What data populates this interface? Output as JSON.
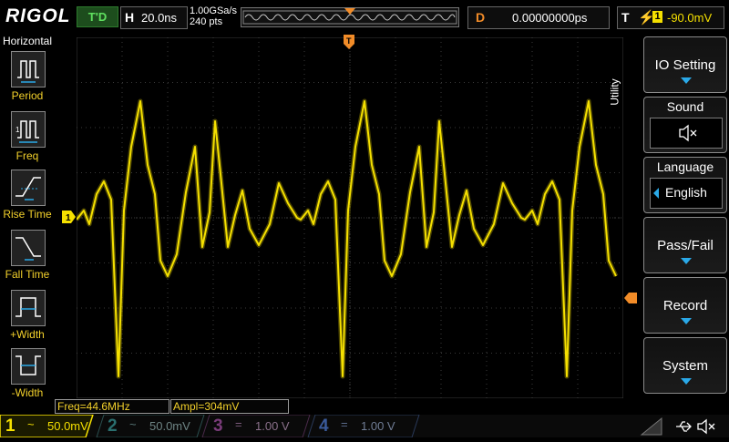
{
  "top": {
    "logo": "RIGOL",
    "trigger_status": "T'D",
    "horizontal_key": "H",
    "timebase": "20.0ns",
    "sample_rate": "1.00GSa/s",
    "points": "240  pts",
    "delay_key": "D",
    "delay_value": "0.00000000ps",
    "trigger_key": "T",
    "trigger_source": "1",
    "trigger_level": "-90.0mV"
  },
  "left_menu": {
    "title": "Horizontal",
    "items": [
      {
        "label": "Period",
        "icon": "period-icon"
      },
      {
        "label": "Freq",
        "icon": "freq-icon"
      },
      {
        "label": "Rise Time",
        "icon": "rise-time-icon"
      },
      {
        "label": "Fall Time",
        "icon": "fall-time-icon"
      },
      {
        "label": "+Width",
        "icon": "pos-width-icon"
      },
      {
        "label": "-Width",
        "icon": "neg-width-icon"
      }
    ]
  },
  "right_menu": {
    "tab_label": "Utility",
    "buttons": [
      {
        "label": "IO Setting"
      },
      {
        "header": "Sound",
        "value_icon": "speaker-mute-icon"
      },
      {
        "header": "Language",
        "value": "English"
      },
      {
        "label": "Pass/Fail"
      },
      {
        "label": "Record"
      },
      {
        "label": "System"
      }
    ]
  },
  "measurements": {
    "freq": "Freq=44.6MHz",
    "ampl": "Ampl=304mV"
  },
  "channels": [
    {
      "num": "1",
      "coupling": "~",
      "scale": "50.0mV",
      "color": "#f5e000",
      "active": true
    },
    {
      "num": "2",
      "coupling": "~",
      "scale": "50.0mV",
      "color": "#2fb7b7",
      "active": false
    },
    {
      "num": "3",
      "coupling": "=",
      "scale": "1.00 V",
      "color": "#c43cc4",
      "active": false
    },
    {
      "num": "4",
      "coupling": "=",
      "scale": "1.00 V",
      "color": "#3a6cd6",
      "active": false
    }
  ],
  "markers": {
    "ch1_marker": "1",
    "trigger_top": "T"
  },
  "colors": {
    "trace": "#f5e000",
    "grid": "#3a3a3a",
    "accent_blue": "#2aa9e8",
    "trigger_orange": "#f28c28"
  }
}
